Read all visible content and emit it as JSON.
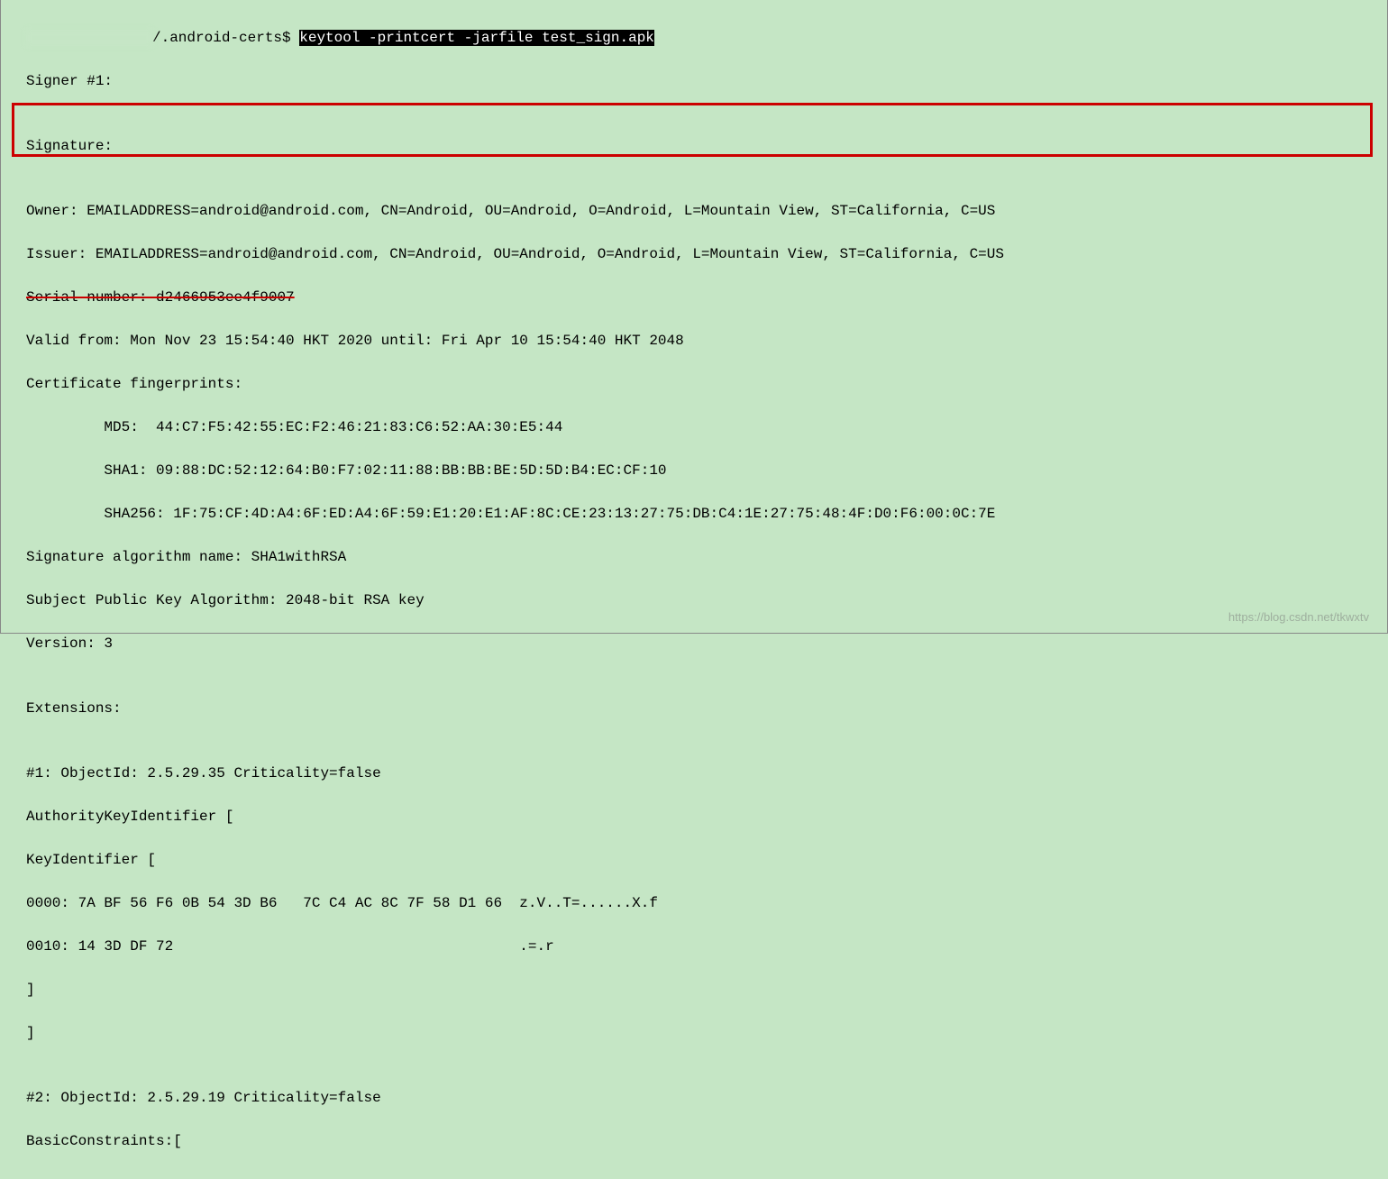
{
  "prompt": {
    "path": "/.android-certs$ ",
    "command": "keytool -printcert -jarfile test_sign.apk"
  },
  "output": {
    "signer": "Signer #1:",
    "blank1": "",
    "signature_header": "Signature:",
    "blank2": "",
    "owner": "Owner: EMAILADDRESS=android@android.com, CN=Android, OU=Android, O=Android, L=Mountain View, ST=California, C=US",
    "issuer": "Issuer: EMAILADDRESS=android@android.com, CN=Android, OU=Android, O=Android, L=Mountain View, ST=California, C=US",
    "serial": "Serial number: d2466953ee4f9007",
    "valid": "Valid from: Mon Nov 23 15:54:40 HKT 2020 until: Fri Apr 10 15:54:40 HKT 2048",
    "fingerprints_header": "Certificate fingerprints:",
    "md5": "         MD5:  44:C7:F5:42:55:EC:F2:46:21:83:C6:52:AA:30:E5:44",
    "sha1": "         SHA1: 09:88:DC:52:12:64:B0:F7:02:11:88:BB:BB:BE:5D:5D:B4:EC:CF:10",
    "sha256": "         SHA256: 1F:75:CF:4D:A4:6F:ED:A4:6F:59:E1:20:E1:AF:8C:CE:23:13:27:75:DB:C4:1E:27:75:48:4F:D0:F6:00:0C:7E",
    "sig_alg": "Signature algorithm name: SHA1withRSA",
    "pubkey": "Subject Public Key Algorithm: 2048-bit RSA key",
    "version": "Version: 3",
    "blank3": "",
    "extensions_header": "Extensions:",
    "blank4": "",
    "ext1_header": "#1: ObjectId: 2.5.29.35 Criticality=false",
    "ext1_name": "AuthorityKeyIdentifier [",
    "ext1_keyid": "KeyIdentifier [",
    "ext1_hex1": "0000: 7A BF 56 F6 0B 54 3D B6   7C C4 AC 8C 7F 58 D1 66  z.V..T=......X.f",
    "ext1_hex2": "0010: 14 3D DF 72                                        .=.r",
    "ext1_close1": "]",
    "ext1_close2": "]",
    "blank5": "",
    "ext2_header": "#2: ObjectId: 2.5.29.19 Criticality=false",
    "ext2_name": "BasicConstraints:["
  },
  "watermark": "https://blog.csdn.net/tkwxtv"
}
